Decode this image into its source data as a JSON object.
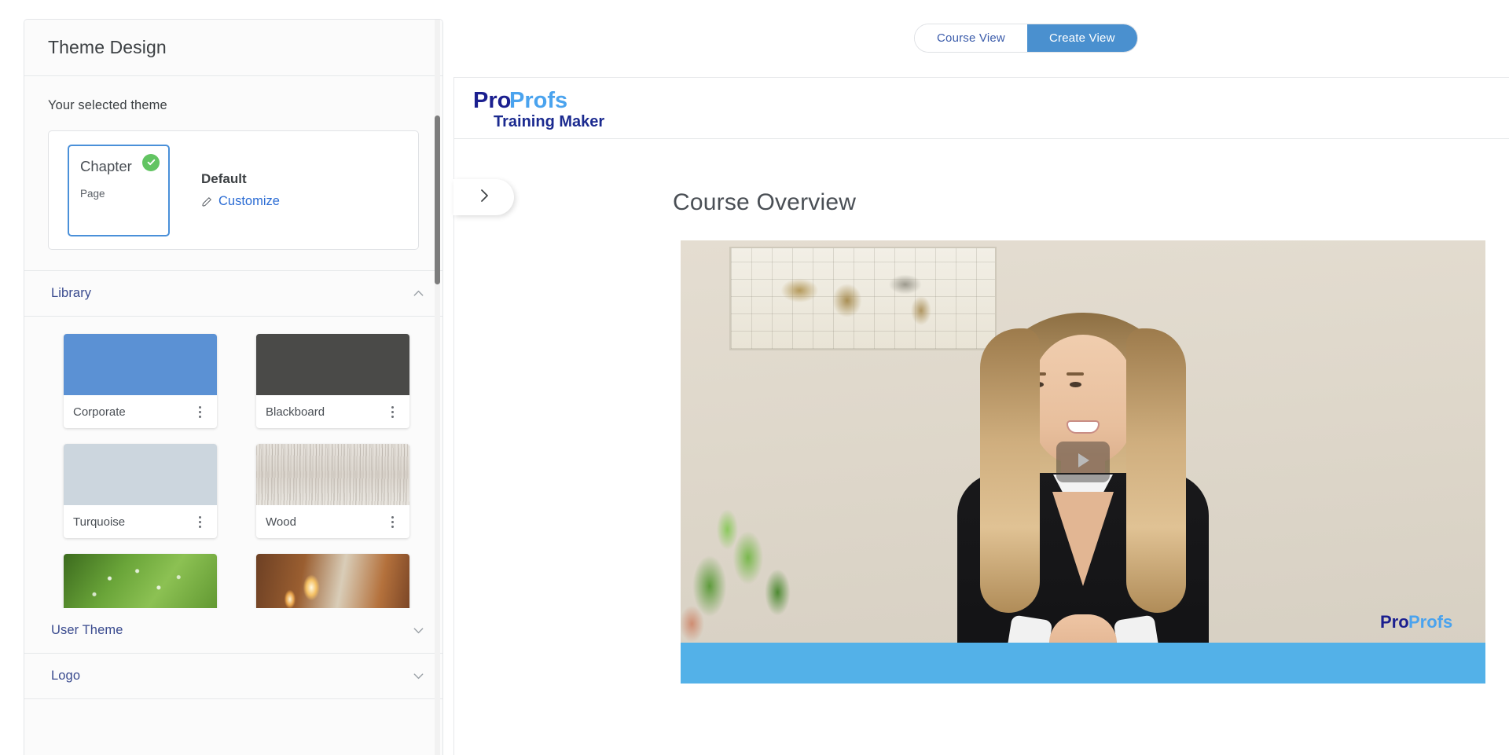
{
  "sidebar": {
    "title": "Theme Design",
    "selected_theme_label": "Your selected theme",
    "selected_theme": {
      "chapter_label": "Chapter",
      "page_label": "Page",
      "name": "Default",
      "customize_label": "Customize",
      "check_color": "#62c462",
      "outline_color": "#4a90d9"
    },
    "sections": [
      {
        "title": "Library",
        "expanded": true,
        "chevron": "chevron-up-icon"
      },
      {
        "title": "User Theme",
        "expanded": false,
        "chevron": "chevron-down-icon"
      },
      {
        "title": "Logo",
        "expanded": false,
        "chevron": "chevron-down-icon"
      }
    ],
    "library_themes": [
      {
        "name": "Corporate",
        "swatch": "sw-corporate",
        "color": "#5b91d4"
      },
      {
        "name": "Blackboard",
        "swatch": "sw-blackboard",
        "color": "#4a4a48"
      },
      {
        "name": "Turquoise",
        "swatch": "sw-turquoise",
        "color": "#ccd6de"
      },
      {
        "name": "Wood",
        "swatch": "sw-wood",
        "color": "#e2ddd5"
      },
      {
        "name": "",
        "swatch": "sw-leaf",
        "color": "#6aa539"
      },
      {
        "name": "",
        "swatch": "sw-candle",
        "color": "#b4713c"
      }
    ],
    "menu_icon": "more-vertical-icon"
  },
  "view_toggle": {
    "course_view": "Course View",
    "create_view": "Create View",
    "active": "Create View",
    "active_color": "#4a90cf",
    "inactive_text_color": "#3a5baa"
  },
  "course": {
    "brand": {
      "pro": "Pro",
      "profs": "Profs",
      "tagline": "Training Maker",
      "pro_color": "#1b1f8f",
      "profs_color": "#4aa3ee",
      "tagline_color": "#1b2a8f"
    },
    "expand_button_icon": "chevron-right-icon",
    "title": "Course Overview",
    "video": {
      "play_icon": "play-icon",
      "watermark_pro": "Pro",
      "watermark_profs": "Profs",
      "bar_color": "#53b1e8"
    }
  }
}
